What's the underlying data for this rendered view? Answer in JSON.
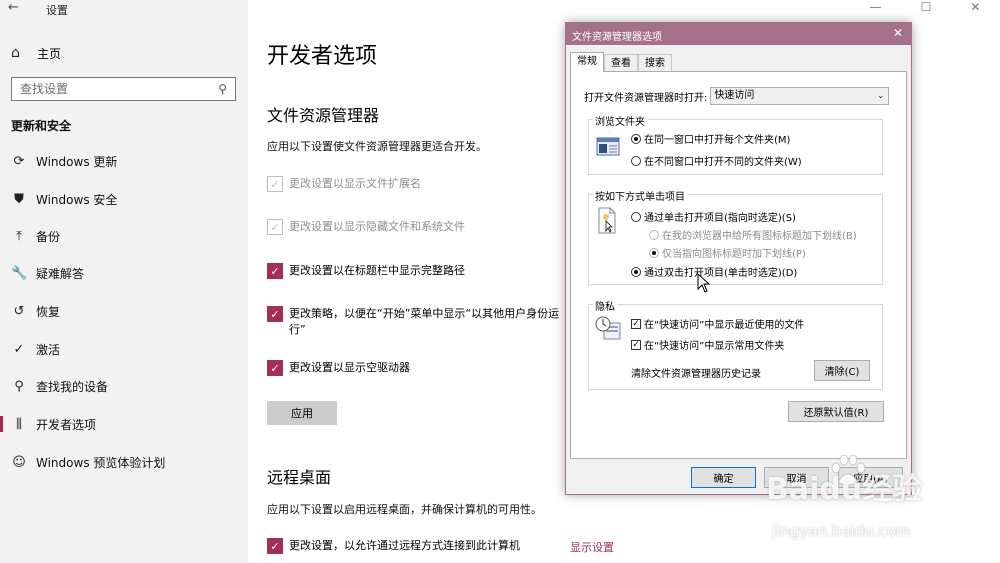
{
  "settings": {
    "app_title": "设置",
    "home_label": "主页",
    "search_placeholder": "查找设置",
    "section_title": "更新和安全",
    "nav": [
      {
        "label": "Windows 更新",
        "icon": "refresh-icon",
        "glyph": "⟳"
      },
      {
        "label": "Windows 安全",
        "icon": "shield-icon",
        "glyph": "⛊"
      },
      {
        "label": "备份",
        "icon": "backup-icon",
        "glyph": "⤒"
      },
      {
        "label": "疑难解答",
        "icon": "wrench-icon",
        "glyph": "🔧"
      },
      {
        "label": "恢复",
        "icon": "history-icon",
        "glyph": "↺"
      },
      {
        "label": "激活",
        "icon": "check-circle-icon",
        "glyph": "✓"
      },
      {
        "label": "查找我的设备",
        "icon": "person-pin-icon",
        "glyph": "⚲"
      },
      {
        "label": "开发者选项",
        "icon": "slider-icon",
        "glyph": "⫼"
      },
      {
        "label": "Windows 预览体验计划",
        "icon": "cat-icon",
        "glyph": "☺"
      }
    ],
    "active_index": 7
  },
  "content": {
    "page_title": "开发者选项",
    "file_explorer_heading": "文件资源管理器",
    "file_explorer_desc": "应用以下设置使文件资源管理器更适合开发。",
    "options": [
      {
        "label": "更改设置以显示文件扩展名",
        "checked": true,
        "dimmed": true
      },
      {
        "label": "更改设置以显示隐藏文件和系统文件",
        "checked": true,
        "dimmed": true
      },
      {
        "label": "更改设置以在标题栏中显示完整路径",
        "checked": true,
        "dimmed": false
      },
      {
        "label": "更改策略，以便在“开始”菜单中显示“以其他用户身份运行”",
        "checked": true,
        "dimmed": false
      },
      {
        "label": "更改设置以显示空驱动器",
        "checked": true,
        "dimmed": false
      }
    ],
    "apply_label": "应用",
    "remote_heading": "远程桌面",
    "remote_desc": "应用以下设置以启用远程桌面，并确保计算机的可用性。",
    "remote_option": "更改设置，以允许通过远程方式连接到此计算机",
    "show_settings_link": "显示设置"
  },
  "dialog": {
    "title": "文件资源管理器选项",
    "tabs": [
      "常规",
      "查看",
      "搜索"
    ],
    "active_tab": 0,
    "open_label": "打开文件资源管理器时打开:",
    "open_value": "快速访问",
    "browse_group": "浏览文件夹",
    "browse_same": "在同一窗口中打开每个文件夹(M)",
    "browse_diff": "在不同窗口中打开不同的文件夹(W)",
    "click_group": "按如下方式单击项目",
    "single_click": "通过单击打开项目(指向时选定)(S)",
    "underline_all": "在我的浏览器中给所有图标标题加下划线(B)",
    "underline_hover": "仅当指向图标标题时加下划线(P)",
    "double_click": "通过双击打开项目(单击时选定)(D)",
    "privacy_group": "隐私",
    "recent_files": "在“快速访问”中显示最近使用的文件",
    "frequent_folders": "在“快速访问”中显示常用文件夹",
    "clear_history_label": "清除文件资源管理器历史记录",
    "clear_button": "清除(C)",
    "restore_button": "还原默认值(R)",
    "ok": "确定",
    "cancel": "取消",
    "apply": "应用(A)"
  },
  "watermark": {
    "brand": "Baidu经验",
    "url": "jingyan.baidu.com"
  },
  "colors": {
    "accent": "#a33053",
    "dialog_title": "#a5718a",
    "left_pane_bg": "#f2f2f2"
  }
}
